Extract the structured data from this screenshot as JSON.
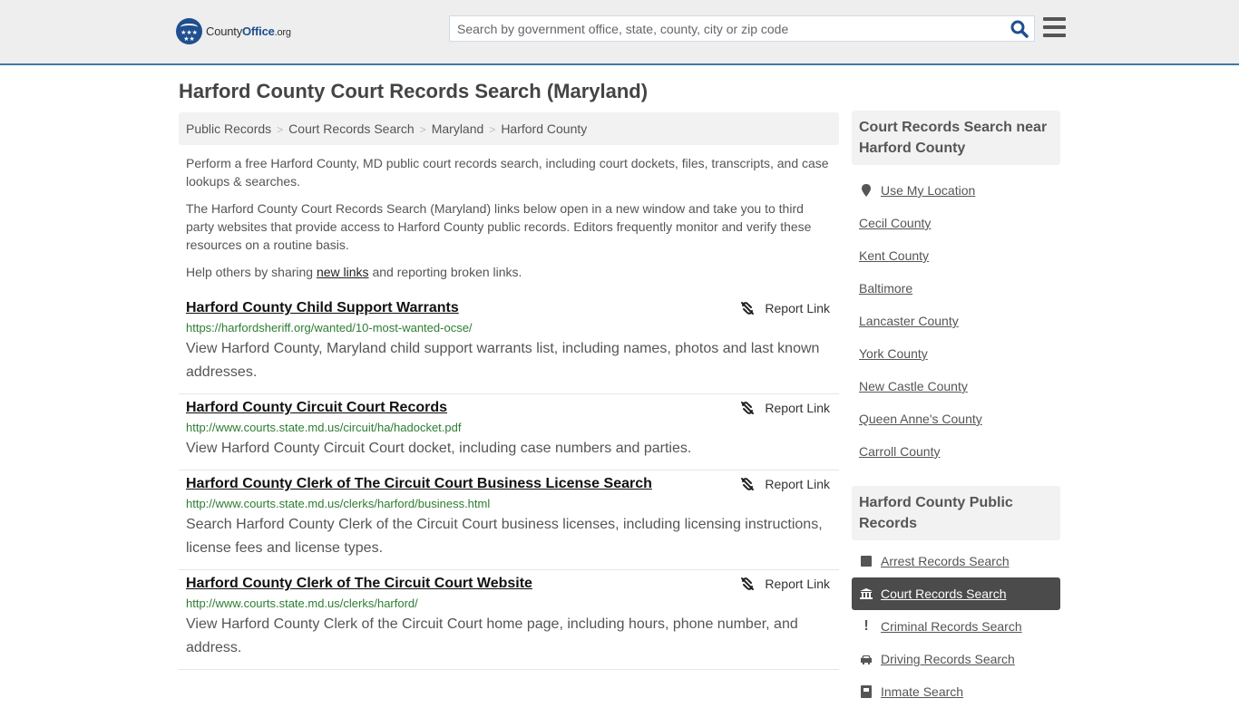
{
  "header": {
    "logo": {
      "part1": "County",
      "part2": "Office",
      "part3": ".org"
    },
    "search": {
      "placeholder": "Search by government office, state, county, city or zip code",
      "value": ""
    },
    "search_icon": "search-icon",
    "menu_icon": "hamburger-menu-icon"
  },
  "page": {
    "title": "Harford County Court Records Search (Maryland)",
    "breadcrumb": [
      "Public Records",
      "Court Records Search",
      "Maryland",
      "Harford County"
    ],
    "intro": {
      "p1": "Perform a free Harford County, MD public court records search, including court dockets, files, transcripts, and case lookups & searches.",
      "p2": "The Harford County Court Records Search (Maryland) links below open in a new window and take you to third party websites that provide access to Harford County public records. Editors frequently monitor and verify these resources on a routine basis.",
      "p3_before": "Help others by sharing ",
      "p3_link": "new links",
      "p3_after": " and reporting broken links."
    }
  },
  "results": [
    {
      "title": "Harford County Child Support Warrants",
      "url": "https://harfordsheriff.org/wanted/10-most-wanted-ocse/",
      "description": "View Harford County, Maryland child support warrants list, including names, photos and last known addresses.",
      "report_label": "Report Link"
    },
    {
      "title": "Harford County Circuit Court Records",
      "url": "http://www.courts.state.md.us/circuit/ha/hadocket.pdf",
      "description": "View Harford County Circuit Court docket, including case numbers and parties.",
      "report_label": "Report Link"
    },
    {
      "title": "Harford County Clerk of The Circuit Court Business License Search",
      "url": "http://www.courts.state.md.us/clerks/harford/business.html",
      "description": "Search Harford County Clerk of the Circuit Court business licenses, including licensing instructions, license fees and license types.",
      "report_label": "Report Link"
    },
    {
      "title": "Harford County Clerk of The Circuit Court Website",
      "url": "http://www.courts.state.md.us/clerks/harford/",
      "description": "View Harford County Clerk of the Circuit Court home page, including hours, phone number, and address.",
      "report_label": "Report Link"
    }
  ],
  "sidebar": {
    "nearby": {
      "heading": "Court Records Search near Harford County",
      "use_location": "Use My Location",
      "items": [
        "Cecil County",
        "Kent County",
        "Baltimore",
        "Lancaster County",
        "York County",
        "New Castle County",
        "Queen Anne's County",
        "Carroll County"
      ]
    },
    "public_records": {
      "heading": "Harford County Public Records",
      "items": [
        {
          "label": "Arrest Records Search",
          "icon": "square-icon",
          "active": false
        },
        {
          "label": "Court Records Search",
          "icon": "courthouse-icon",
          "active": true
        },
        {
          "label": "Criminal Records Search",
          "icon": "exclamation-icon",
          "active": false
        },
        {
          "label": "Driving Records Search",
          "icon": "car-icon",
          "active": false
        },
        {
          "label": "Inmate Search",
          "icon": "inmate-icon",
          "active": false
        }
      ]
    }
  }
}
